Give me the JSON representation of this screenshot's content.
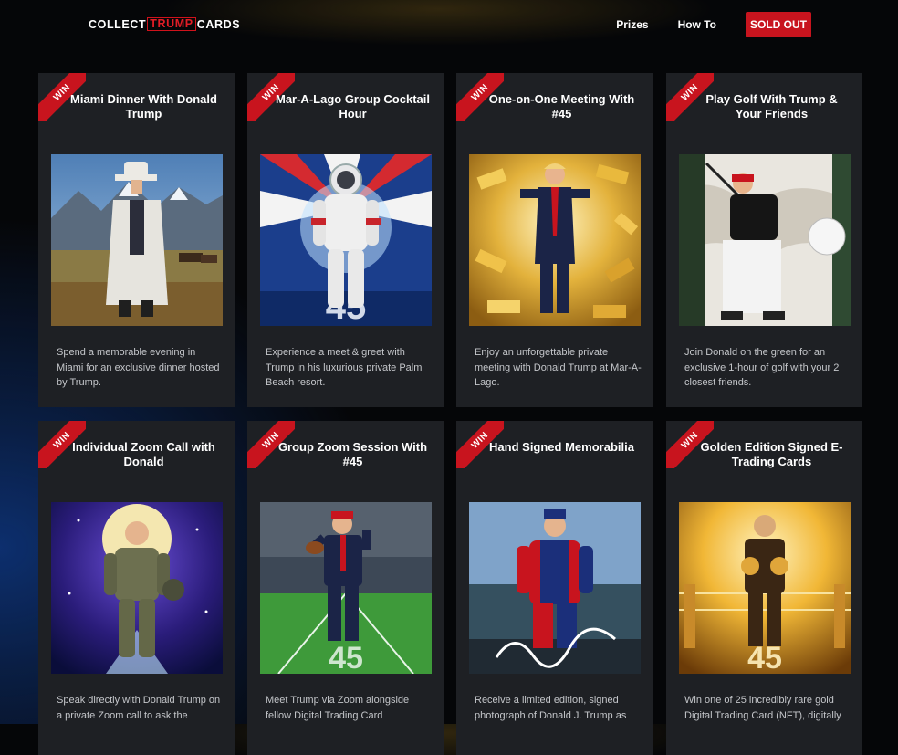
{
  "header": {
    "logo": {
      "part1": "COLLECT",
      "part2": "TRUMP",
      "part3": "CARDS"
    },
    "nav": [
      {
        "label": "Prizes"
      },
      {
        "label": "How To"
      }
    ],
    "cta": {
      "label": "SOLD OUT"
    }
  },
  "prizes": [
    {
      "badge": "WIN",
      "title": "Miami Dinner With Donald Trump",
      "description": "Spend a memorable evening in Miami for an exclusive dinner hosted by Trump.",
      "icon": "cowboy-landscape-image"
    },
    {
      "badge": "WIN",
      "title": "Mar-A-Lago Group Cocktail Hour",
      "description": "Experience a meet & greet with Trump in his luxurious private Palm Beach resort.",
      "icon": "astronaut-image"
    },
    {
      "badge": "WIN",
      "title": "One-on-One Meeting With #45",
      "description": "Enjoy an unforgettable private meeting with Donald Trump at Mar-A-Lago.",
      "icon": "gold-bars-image"
    },
    {
      "badge": "WIN",
      "title": "Play Golf With Trump & Your Friends",
      "description": "Join Donald on the green for an exclusive 1-hour of golf with your 2 closest friends.",
      "icon": "golfer-image"
    },
    {
      "badge": "WIN",
      "title": "Individual Zoom Call with Donald",
      "description": "Speak directly with Donald Trump on a private Zoom call to ask the",
      "icon": "pilot-moon-image"
    },
    {
      "badge": "WIN",
      "title": "Group Zoom Session With #45",
      "description": "Meet Trump via Zoom alongside fellow Digital Trading Card",
      "icon": "football-stadium-image"
    },
    {
      "badge": "WIN",
      "title": "Hand Signed Memorabilia",
      "description": "Receive a limited edition, signed photograph of Donald J. Trump as",
      "icon": "race-driver-image"
    },
    {
      "badge": "WIN",
      "title": "Golden Edition Signed E-Trading Cards",
      "description": "Win one of 25 incredibly rare gold Digital Trading Card (NFT), digitally",
      "icon": "gold-boxer-image"
    }
  ]
}
